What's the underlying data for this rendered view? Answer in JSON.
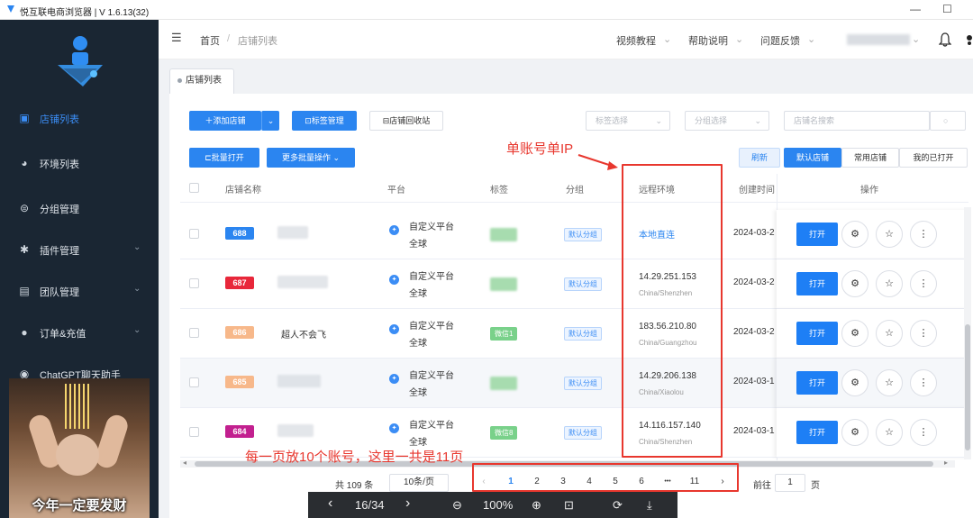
{
  "titlebar": {
    "title": "悦互联电商浏览器 | V 1.6.13(32)",
    "min": "—",
    "max": "☐"
  },
  "sidebar": {
    "items": [
      {
        "label": "店铺列表",
        "icon": "store-icon",
        "glyph": "▣"
      },
      {
        "label": "环境列表",
        "icon": "globe-icon",
        "glyph": "◕"
      },
      {
        "label": "分组管理",
        "icon": "group-icon",
        "glyph": "⊜"
      },
      {
        "label": "插件管理",
        "icon": "plugin-icon",
        "glyph": "✱"
      },
      {
        "label": "团队管理",
        "icon": "team-icon",
        "glyph": "▤"
      },
      {
        "label": "订单&充值",
        "icon": "order-icon",
        "glyph": "●"
      },
      {
        "label": "ChatGPT聊天助手",
        "icon": "chat-icon",
        "glyph": "◉"
      }
    ],
    "chev": "⌄"
  },
  "header": {
    "menu_glyph": "☰",
    "crumb_home": "首页",
    "crumb_sep": "/",
    "crumb_current": "店铺列表",
    "video": "视频教程",
    "help": "帮助说明",
    "feedback": "问题反馈",
    "chev": "⌄",
    "bell": "🔔"
  },
  "tabs": [
    {
      "label": "店铺列表"
    }
  ],
  "toolbar": {
    "add": "＋添加店铺",
    "add_chev": "⌄",
    "tag_mgmt": "标签管理",
    "tag_glyph": "⊡",
    "recycle": "店铺回收站",
    "recycle_glyph": "⊟",
    "tag_select": "标签选择",
    "group_select": "分组选择",
    "search_placeholder": "店铺名搜索",
    "search_glyph": "○",
    "batch_open": "批量打开",
    "batch_glyph": "⊏",
    "more_batch": "更多批量操作",
    "refresh": "刷新",
    "default_shop": "默认店铺",
    "common_shop": "常用店铺",
    "my_opened": "我的已打开"
  },
  "table": {
    "headers": {
      "name": "店铺名称",
      "platform": "平台",
      "tag": "标签",
      "group": "分组",
      "env": "远程环境",
      "created": "创建时间",
      "ops": "操作"
    },
    "rows": [
      {
        "id": "688",
        "id_color": "#2b85f0",
        "name": "",
        "platform": "自定义平台",
        "region": "全球",
        "tag": "",
        "group": "默认分组",
        "env": "本地直连",
        "env_sub": "",
        "created": "2024-03-2"
      },
      {
        "id": "687",
        "id_color": "#e8273a",
        "name": "",
        "platform": "自定义平台",
        "region": "全球",
        "tag": "",
        "group": "默认分组",
        "env": "14.29.251.153",
        "env_sub": "China/Shenzhen",
        "created": "2024-03-2"
      },
      {
        "id": "686",
        "id_color": "#f7b88a",
        "name": "超人不会飞",
        "platform": "自定义平台",
        "region": "全球",
        "tag": "微信1",
        "group": "默认分组",
        "env": "183.56.210.80",
        "env_sub": "China/Guangzhou",
        "created": "2024-03-2"
      },
      {
        "id": "685",
        "id_color": "#f7b88a",
        "name": "",
        "platform": "自定义平台",
        "region": "全球",
        "tag": "",
        "group": "默认分组",
        "env": "14.29.206.138",
        "env_sub": "China/Xiaolou",
        "created": "2024-03-1"
      },
      {
        "id": "684",
        "id_color": "#c2208f",
        "name": "",
        "platform": "自定义平台",
        "region": "全球",
        "tag": "微信8",
        "group": "默认分组",
        "env": "14.116.157.140",
        "env_sub": "China/Shenzhen",
        "created": "2024-03-1"
      }
    ],
    "open_label": "打开",
    "gear": "⚙",
    "star": "☆",
    "more": "⋮",
    "plat_glyph": "✦"
  },
  "annotations": {
    "single_ip": "单账号单IP",
    "arrow": "→",
    "pages_note": "每一页放10个账号，这里一共是11页"
  },
  "pager": {
    "total": "共 109 条",
    "size": "10条/页",
    "prev": "‹",
    "pages": [
      "1",
      "2",
      "3",
      "4",
      "5",
      "6",
      "•••",
      "11"
    ],
    "next": "›",
    "goto": "前往",
    "goto_val": "1",
    "page_suffix": "页",
    "scroll_left": "◂",
    "scroll_right": "▸"
  },
  "viewer": {
    "prev": "‹",
    "counter": "16/34",
    "next": "›",
    "zoom_out": "⊖",
    "zoom": "100%",
    "zoom_in": "⊕",
    "fit": "⊡",
    "rotate": "⟳",
    "download": "⤓"
  },
  "meme": {
    "caption": "今年一定要发财"
  }
}
